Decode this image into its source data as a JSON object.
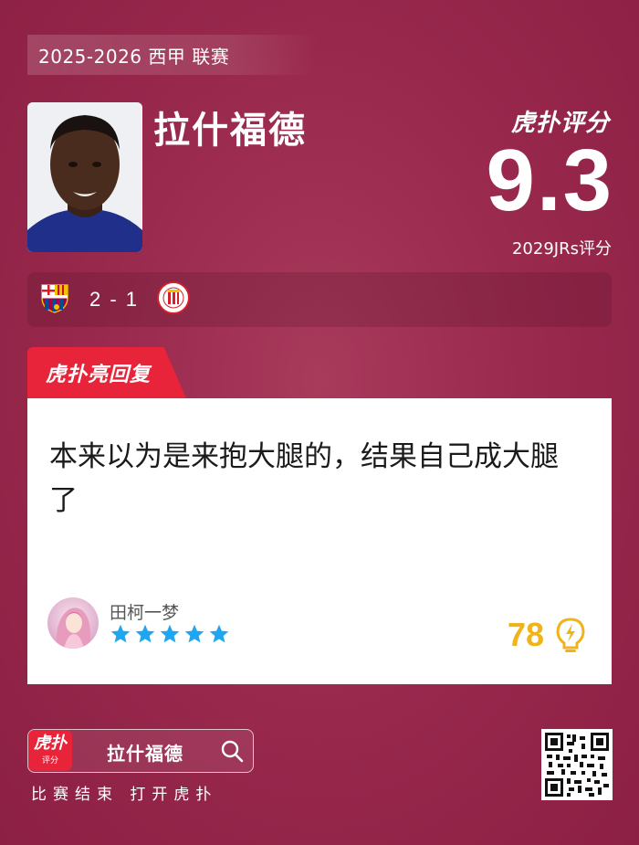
{
  "header": {
    "league_tag": "2025-2026 西甲 联赛",
    "player_name": "拉什福德",
    "brand_logo": "虎扑评分",
    "score": "9.3",
    "score_sub": "2029JRs评分"
  },
  "match": {
    "home_team_icon": "barcelona-crest-icon",
    "away_team_icon": "girona-crest-icon",
    "score": "2 - 1"
  },
  "reply": {
    "tab_label": "虎扑亮回复",
    "comment": "本来以为是来抱大腿的，结果自己成大腿了",
    "username": "田柯一梦",
    "star_rating": 5,
    "like_count": "78",
    "star_color": "#1ea7f0",
    "like_color": "#f0b41a"
  },
  "footer": {
    "app_icon_big": "虎扑",
    "app_icon_small": "评分",
    "search_label": "拉什福德",
    "hint": "比赛结束 打开虎扑"
  },
  "colors": {
    "background": "#9a2a4e",
    "accent_red": "#e8243a"
  }
}
